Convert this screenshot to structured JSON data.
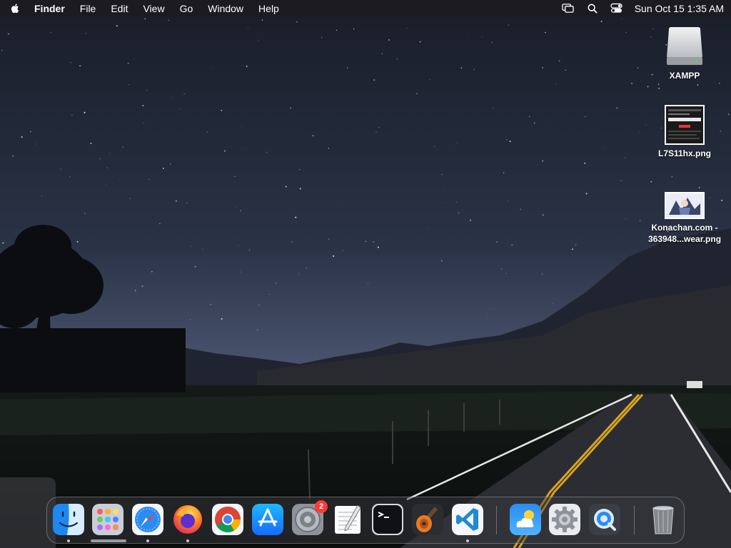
{
  "menubar": {
    "app_name": "Finder",
    "menus": [
      "File",
      "Edit",
      "View",
      "Go",
      "Window",
      "Help"
    ],
    "clock": "Sun Oct 15  1:35 AM",
    "status_icons": [
      "screen-mirroring-icon",
      "spotlight-search-icon",
      "control-center-icon"
    ]
  },
  "desktop": {
    "icons": [
      {
        "label": "XAMPP",
        "icon": "drive-icon"
      },
      {
        "label": "L7S11hx.png",
        "icon": "png-thumbnail-icon"
      },
      {
        "label_line1": "Konachan.com -",
        "label_line2": "363948...wear.png",
        "icon": "png-thumbnail-icon"
      }
    ]
  },
  "dock": {
    "apps": [
      {
        "name": "Finder",
        "running": true
      },
      {
        "name": "Launchpad",
        "running": false
      },
      {
        "name": "Safari",
        "running": true
      },
      {
        "name": "Firefox",
        "running": true
      },
      {
        "name": "Google Chrome",
        "running": false
      },
      {
        "name": "App Store",
        "running": false
      },
      {
        "name": "System Preferences",
        "running": false,
        "badge": "2"
      },
      {
        "name": "TextEdit",
        "running": false
      },
      {
        "name": "Terminal",
        "running": false
      },
      {
        "name": "GarageBand",
        "running": false
      },
      {
        "name": "Visual Studio Code",
        "running": true
      },
      {
        "name": "Weather",
        "running": false
      },
      {
        "name": "System Settings",
        "running": false
      },
      {
        "name": "QuickTime Player",
        "running": false
      },
      {
        "name": "Trash",
        "running": false
      }
    ]
  }
}
